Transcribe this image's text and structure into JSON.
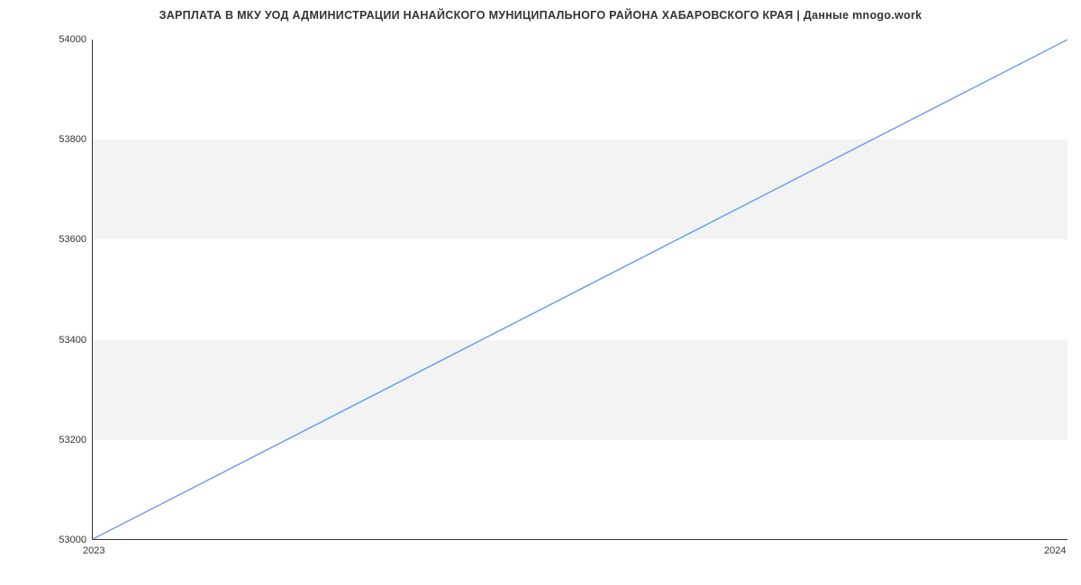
{
  "chart_data": {
    "type": "line",
    "title": "ЗАРПЛАТА В МКУ УОД АДМИНИСТРАЦИИ НАНАЙСКОГО МУНИЦИПАЛЬНОГО РАЙОНА ХАБАРОВСКОГО КРАЯ | Данные mnogo.work",
    "x": [
      2023,
      2024
    ],
    "values": [
      53000,
      54000
    ],
    "xlabel": "",
    "ylabel": "",
    "xlim": [
      2023,
      2024
    ],
    "ylim": [
      53000,
      54000
    ],
    "y_ticks": [
      53000,
      53200,
      53400,
      53600,
      53800,
      54000
    ],
    "x_ticks": [
      2023,
      2024
    ],
    "line_color": "#6f9df0"
  }
}
